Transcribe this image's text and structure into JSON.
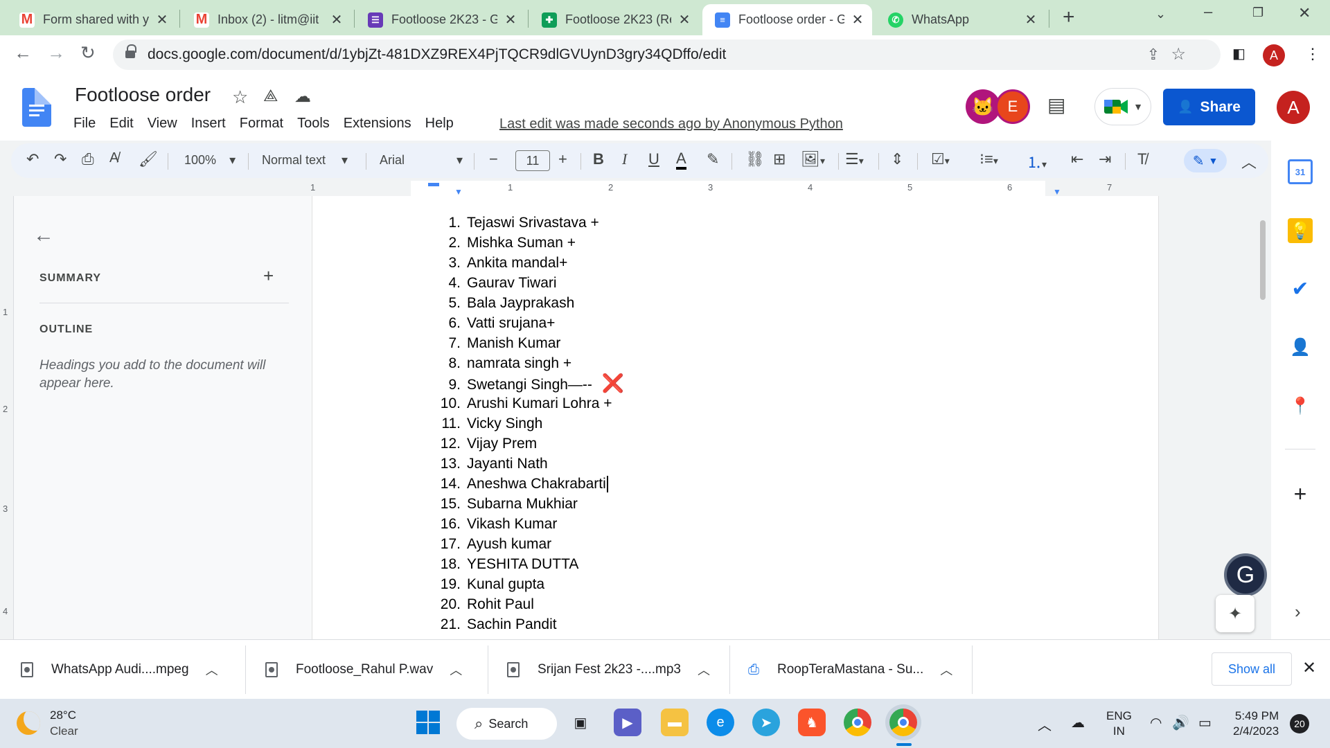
{
  "browser": {
    "tabs": [
      {
        "title": "Form shared with y",
        "icon": "gmail-icon"
      },
      {
        "title": "Inbox (2) - litm@iit",
        "icon": "gmail-icon"
      },
      {
        "title": "Footloose 2K23 - G",
        "icon": "google-forms-icon"
      },
      {
        "title": "Footloose 2K23 (Re",
        "icon": "google-sheets-icon"
      },
      {
        "title": "Footloose order - G",
        "icon": "google-docs-icon",
        "active": true
      },
      {
        "title": "WhatsApp",
        "icon": "whatsapp-icon"
      }
    ],
    "url": "docs.google.com/document/d/1ybjZt-481DXZ9REX4PjTQCR9dlGVUynD3gry34QDffo/edit",
    "profile_initial": "A"
  },
  "docs": {
    "title": "Footloose order",
    "menu": [
      "File",
      "Edit",
      "View",
      "Insert",
      "Format",
      "Tools",
      "Extensions",
      "Help"
    ],
    "last_edit": "Last edit was made seconds ago by Anonymous Python",
    "collaborator_initial": "E",
    "share_label": "Share",
    "user_initial": "A"
  },
  "toolbar": {
    "zoom": "100%",
    "style": "Normal text",
    "font": "Arial",
    "font_size": "11"
  },
  "ruler": {
    "h_numbers": [
      "1",
      "1",
      "2",
      "3",
      "4",
      "5",
      "6",
      "7"
    ],
    "v_numbers": [
      "1",
      "2",
      "3",
      "4"
    ]
  },
  "outline": {
    "summary_label": "SUMMARY",
    "outline_label": "OUTLINE",
    "hint": "Headings you add to the document will appear here."
  },
  "document": {
    "items": [
      {
        "num": "1.",
        "text": "Tejaswi Srivastava +"
      },
      {
        "num": "2.",
        "text": "Mishka Suman +"
      },
      {
        "num": "3.",
        "text": "Ankita mandal+"
      },
      {
        "num": "4.",
        "text": "Gaurav Tiwari"
      },
      {
        "num": "5.",
        "text": "Bala Jayprakash"
      },
      {
        "num": "6.",
        "text": "Vatti srujana+"
      },
      {
        "num": "7.",
        "text": "Manish Kumar"
      },
      {
        "num": "8.",
        "text": "namrata singh +"
      },
      {
        "num": "9.",
        "text": "Swetangi Singh—-- ",
        "mark": "❌"
      },
      {
        "num": "10.",
        "text": "Arushi Kumari Lohra +"
      },
      {
        "num": "11.",
        "text": "Vicky Singh"
      },
      {
        "num": "12.",
        "text": "Vijay Prem"
      },
      {
        "num": "13.",
        "text": "Jayanti Nath"
      },
      {
        "num": "14.",
        "text": "Aneshwa Chakrabarti",
        "caret": true
      },
      {
        "num": "15.",
        "text": "Subarna Mukhiar"
      },
      {
        "num": "16.",
        "text": "Vikash Kumar"
      },
      {
        "num": "17.",
        "text": "Ayush kumar"
      },
      {
        "num": "18.",
        "text": "YESHITA DUTTA"
      },
      {
        "num": "19.",
        "text": "Kunal gupta"
      },
      {
        "num": "20.",
        "text": "Rohit Paul"
      },
      {
        "num": "21.",
        "text": "Sachin Pandit"
      }
    ]
  },
  "downloads": {
    "items": [
      {
        "name": "WhatsApp Audi....mpeg"
      },
      {
        "name": "Footloose_Rahul P.wav"
      },
      {
        "name": "Srijan Fest 2k23 -....mp3"
      },
      {
        "name": "RoopTeraMastana - Su..."
      }
    ],
    "show_all": "Show all"
  },
  "taskbar": {
    "temp": "28°C",
    "condition": "Clear",
    "search_label": "Search",
    "lang1": "ENG",
    "lang2": "IN",
    "time": "5:49 PM",
    "date": "2/4/2023",
    "notifications": "20"
  },
  "colors": {
    "tabstrip": "#cfe8d2",
    "share_button": "#0b57d0",
    "red_x": "#e8345a"
  }
}
